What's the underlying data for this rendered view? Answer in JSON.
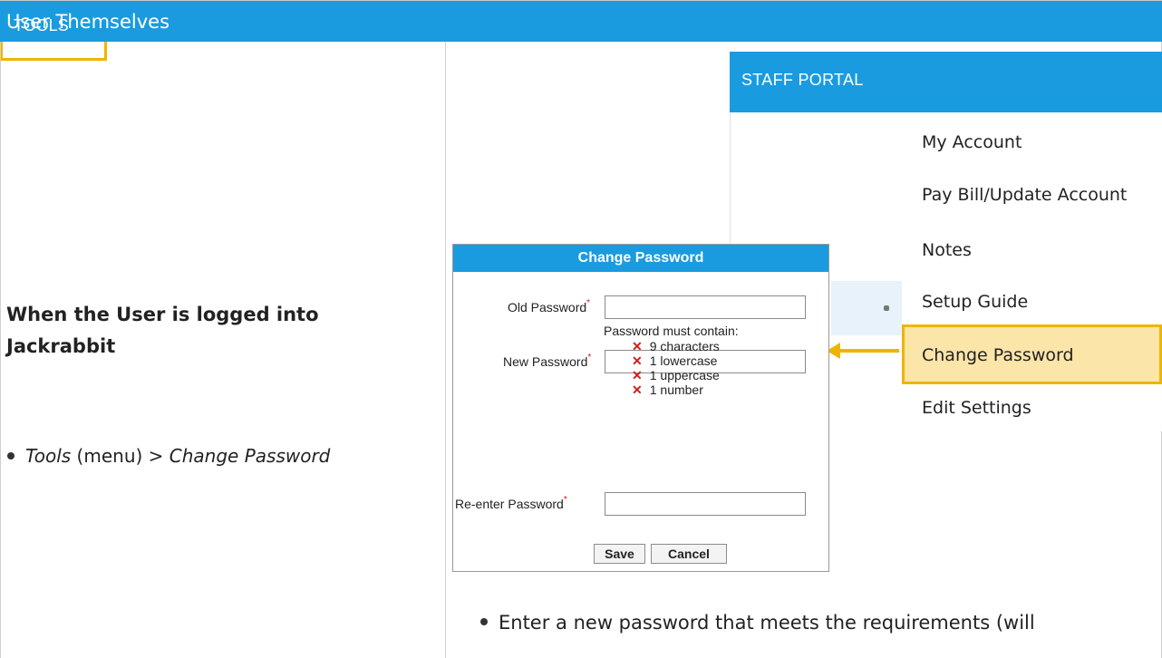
{
  "header": {
    "title": "User Themselves"
  },
  "left": {
    "heading": "When the User is logged into Jackrabbit",
    "bullet_menu": "Tools",
    "bullet_middle": " (menu) > ",
    "bullet_item": "Change Password"
  },
  "nav": {
    "staff_portal": "STAFF PORTAL",
    "tools": "TOOLS"
  },
  "dropdown": {
    "items": [
      "My Account",
      "Pay Bill/Update Account",
      "Notes",
      "Setup Guide",
      "Change Password",
      "Edit Settings"
    ],
    "highlight_color": "#fbe5a9"
  },
  "dialog": {
    "title": "Change Password",
    "old_label": "Old Password",
    "new_label": "New Password",
    "reenter_label": "Re-enter Password",
    "required_mark": "*",
    "rules_heading": "Password must contain:",
    "rules": [
      "9 characters",
      "1 lowercase",
      "1 uppercase",
      "1 number"
    ],
    "rule_marker": "✕",
    "save_label": "Save",
    "cancel_label": "Cancel"
  },
  "bottom": {
    "bullet": "Enter a new password that meets the requirements (will"
  },
  "colors": {
    "accent": "#1a9be0",
    "highlight_border": "#f0b400",
    "error": "#d21c1c"
  }
}
